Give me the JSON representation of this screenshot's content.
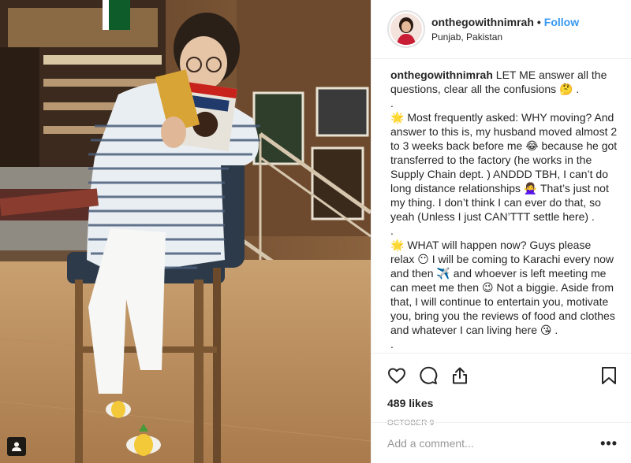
{
  "post": {
    "username": "onthegowithnimrah",
    "separator": "•",
    "follow_label": "Follow",
    "location": "Punjab, Pakistan",
    "caption_user": "onthegowithnimrah",
    "caption_text": "LET ME answer all the questions, clear all the confusions 🤔 .\n.\n🌟 Most frequently asked: WHY moving? And answer to this is, my husband moved almost 2 to 3 weeks back before me 😂 because he got transferred to the factory (he works in the Supply Chain dept. ) ANDDD TBH, I can’t do long distance relationships 🙅‍♀️ That’s just not my thing. I don’t think I can ever do that, so yeah (Unless I just CAN’TTT settle here) .\n.\n🌟 WHAT will happen now? Guys please relax 😶 I will be coming to Karachi every now and then ✈️ and whoever is left meeting me can meet me then 😉 Not a biggie. Aside from that, I will continue to entertain you, motivate you, bring you the reviews of food and clothes and whatever I can living here 😘 .\n.\n🌟 WHERE HAVE I MOVED? Hahaha okay I’m",
    "likes": "489 likes",
    "date": "OCTOBER 9",
    "comment_placeholder": "Add a comment...",
    "more_label": "•••"
  },
  "icons": {
    "like": "heart-icon",
    "comment": "comment-icon",
    "share": "share-icon",
    "save": "bookmark-icon",
    "photo_badge": "user-tag-icon"
  },
  "colors": {
    "follow": "#3897f0",
    "text": "#262626",
    "muted": "#999999",
    "divider": "#efefef"
  }
}
